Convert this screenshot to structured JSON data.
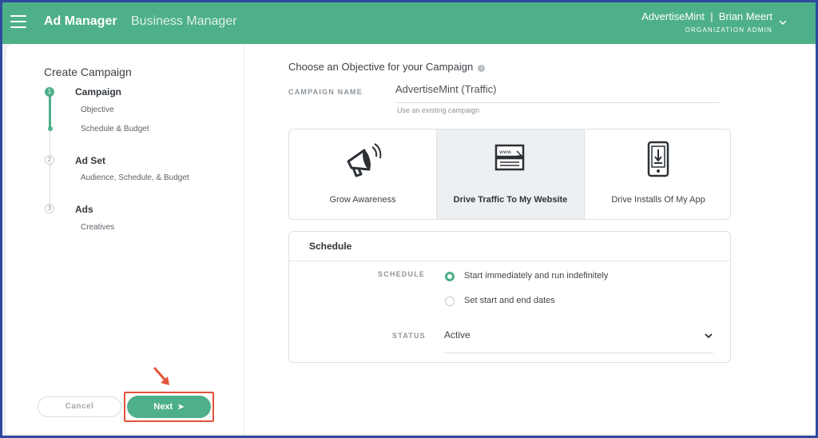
{
  "header": {
    "brand": "Ad Manager",
    "secondary_app": "Business Manager",
    "account_name": "AdvertiseMint  |  Brian Meert",
    "account_role": "ORGANIZATION ADMIN"
  },
  "sidebar": {
    "title": "Create Campaign",
    "steps": [
      {
        "number": "1",
        "label": "Campaign",
        "subs": [
          "Objective",
          "Schedule & Budget"
        ],
        "active": true
      },
      {
        "number": "2",
        "label": "Ad Set",
        "subs": [
          "Audience, Schedule, & Budget"
        ],
        "active": false
      },
      {
        "number": "3",
        "label": "Ads",
        "subs": [
          "Creatives"
        ],
        "active": false
      }
    ],
    "cancel_label": "Cancel",
    "next_label": "Next",
    "next_arrow": "➤"
  },
  "main": {
    "title": "Choose an Objective for your Campaign",
    "info_glyph": "i",
    "campaign_name_label": "CAMPAIGN NAME",
    "campaign_name_value": "AdvertiseMint (Traffic)",
    "existing_link": "Use an existing campaign",
    "objectives": [
      {
        "label": "Grow Awareness",
        "icon": "megaphone-icon",
        "selected": false
      },
      {
        "label": "Drive Traffic To My Website",
        "icon": "browser-window-icon",
        "selected": true,
        "icon_text": "www."
      },
      {
        "label": "Drive Installs Of My App",
        "icon": "phone-download-icon",
        "selected": false
      }
    ],
    "schedule": {
      "title": "Schedule",
      "schedule_label": "SCHEDULE",
      "options": [
        {
          "label": "Start immediately and run indefinitely",
          "selected": true
        },
        {
          "label": "Set start and end dates",
          "selected": false
        }
      ],
      "status_label": "STATUS",
      "status_value": "Active"
    }
  },
  "colors": {
    "accent": "#4eb088",
    "frame_border": "#2d4a9e",
    "highlight": "#e3533a"
  }
}
